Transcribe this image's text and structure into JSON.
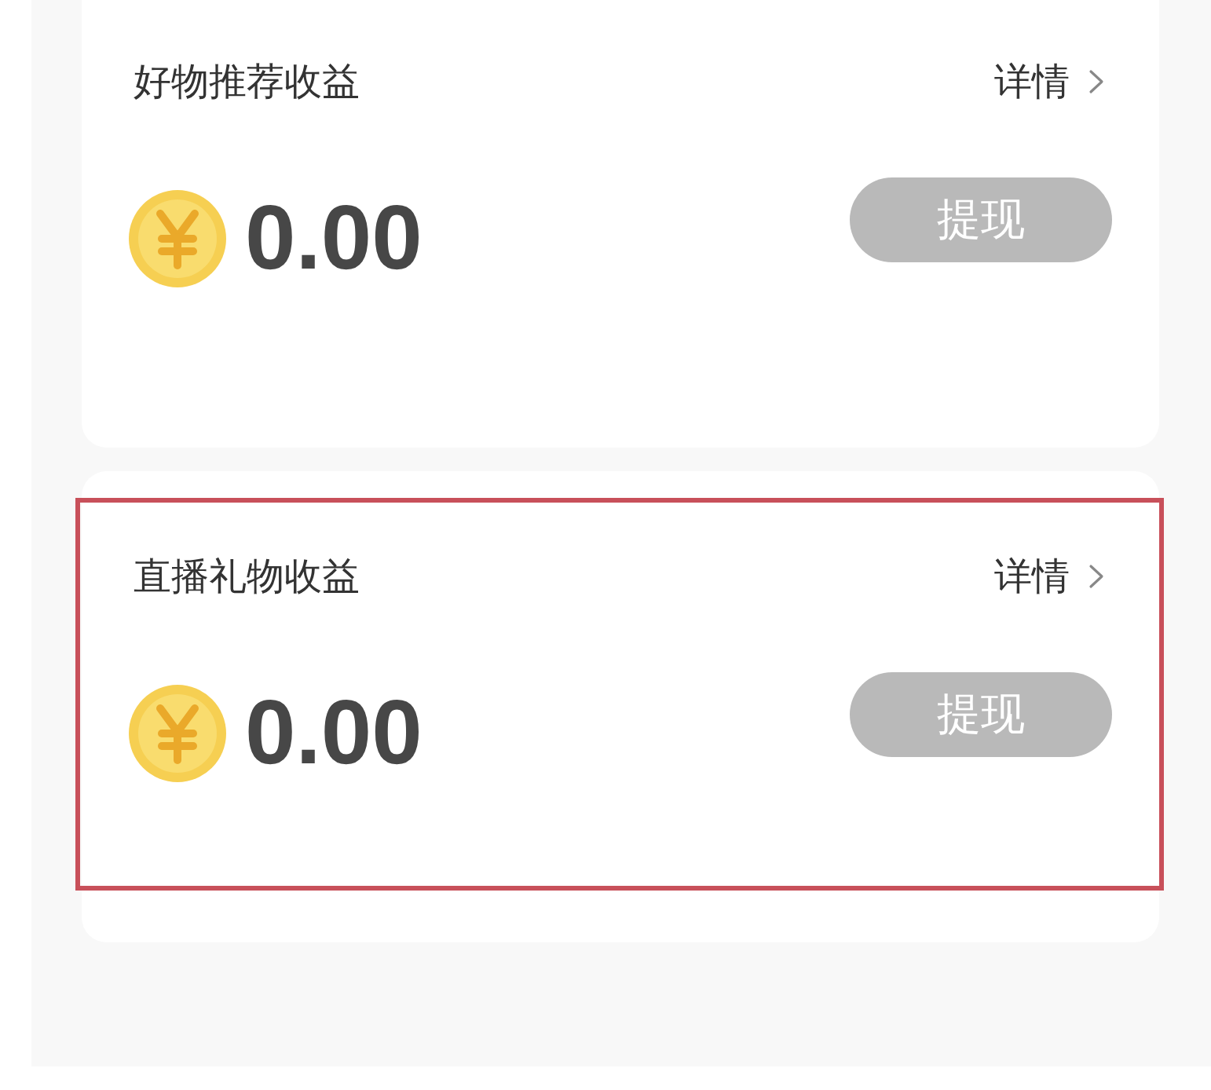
{
  "cards": [
    {
      "title": "好物推荐收益",
      "detail_link": "详情",
      "amount": "0.00",
      "withdraw_button": {
        "label": "提现",
        "disabled": true
      },
      "highlighted": false
    },
    {
      "title": "直播礼物收益",
      "detail_link": "详情",
      "amount": "0.00",
      "withdraw_button": {
        "label": "提现",
        "disabled": true
      },
      "highlighted": true
    }
  ]
}
